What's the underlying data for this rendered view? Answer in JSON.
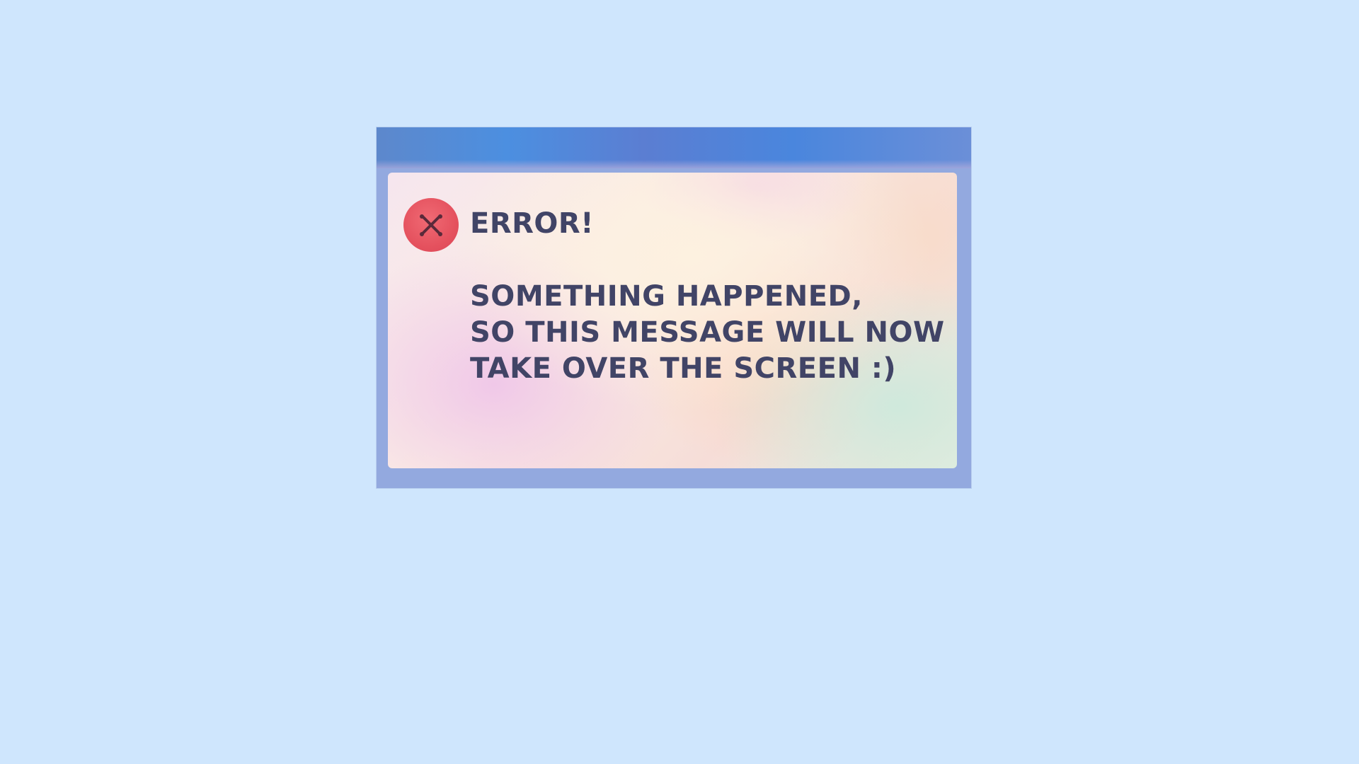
{
  "dialog": {
    "title": "ERROR!",
    "icon": "error-x-icon",
    "message_lines": [
      "SOMETHING HAPPENED,",
      "SO THIS MESSAGE WILL NOW",
      "TAKE OVER THE SCREEN :)"
    ]
  },
  "colors": {
    "background": "#cfe6fd",
    "titlebar": "#4f86d8",
    "error_icon": "#e4505d",
    "text": "#414466"
  }
}
